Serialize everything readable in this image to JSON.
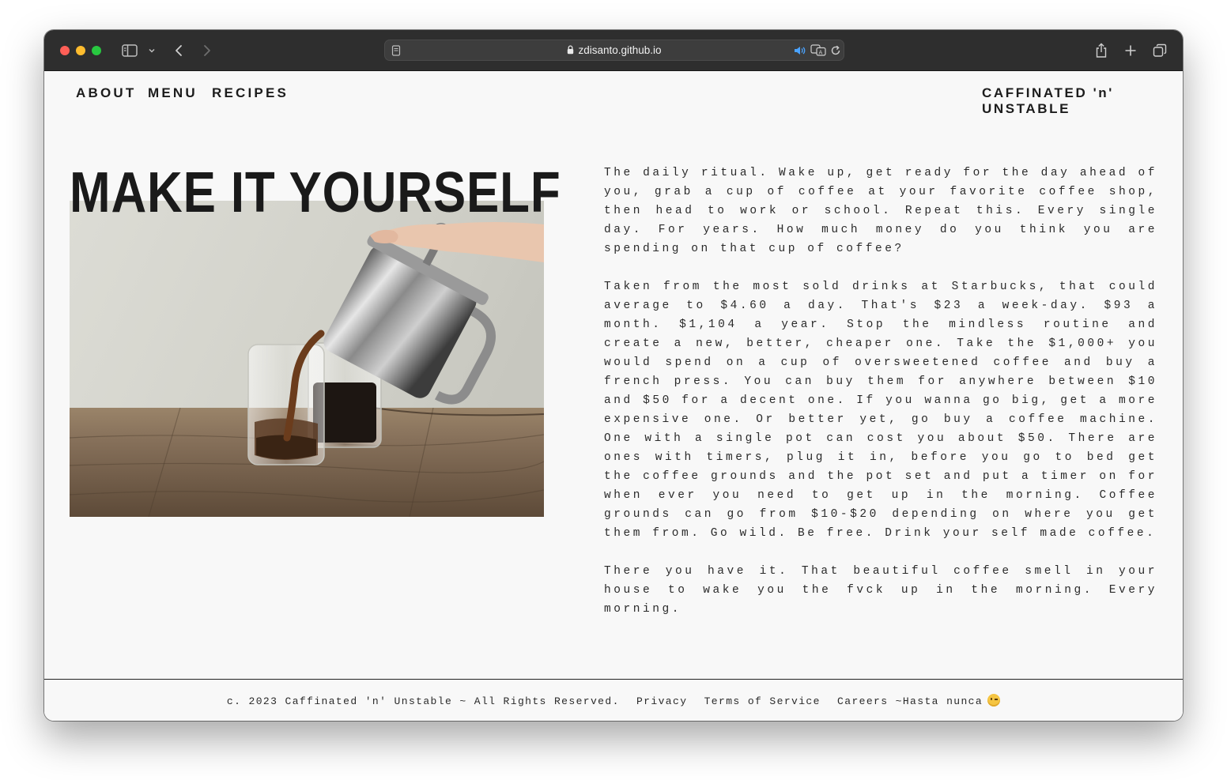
{
  "browser": {
    "url": "zdisanto.github.io"
  },
  "nav": {
    "items": [
      "ABOUT",
      "MENU",
      "RECIPES"
    ],
    "brand": "CAFFINATED 'n' UNSTABLE"
  },
  "hero": {
    "title": "MAKE IT YOURSELF"
  },
  "article": {
    "paragraphs": [
      "The daily ritual. Wake up, get ready for the day ahead of you, grab a cup of coffee at your favorite coffee shop, then head to work or school. Repeat this. Every single day. For years. How much money do you think you are spending on that cup of coffee?",
      "Taken from the most sold drinks at Starbucks, that could average to $4.60 a day. That's $23 a week-day. $93 a month. $1,104 a year. Stop the mindless routine and create a new, better, cheaper one. Take the $1,000+ you would spend on a cup of oversweetened coffee and buy a french press. You can buy them for anywhere between $10 and $50 for a decent one. If you wanna go big, get a more expensive one. Or better yet, go buy a coffee machine. One with a single pot can cost you about $50. There are ones with timers, plug it in, before you go to bed get the coffee grounds and the pot set and put a timer on for when ever you need to get up in the morning. Coffee grounds can go from $10-$20 depending on where you get them from. Go wild. Be free. Drink your self made coffee.",
      "There you have it. That beautiful coffee smell in your house to wake you the fvck up in the morning. Every morning."
    ]
  },
  "footer": {
    "copyright": "c. 2023 Caffinated 'n' Unstable ~ All Rights Reserved.",
    "privacy": "Privacy",
    "terms": "Terms of Service",
    "careers": "Careers ~Hasta nunca"
  }
}
